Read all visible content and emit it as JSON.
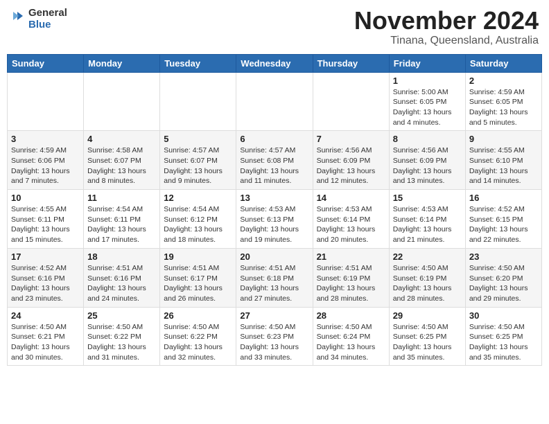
{
  "header": {
    "logo_general": "General",
    "logo_blue": "Blue",
    "month": "November 2024",
    "location": "Tinana, Queensland, Australia"
  },
  "weekdays": [
    "Sunday",
    "Monday",
    "Tuesday",
    "Wednesday",
    "Thursday",
    "Friday",
    "Saturday"
  ],
  "weeks": [
    [
      {
        "day": "",
        "info": ""
      },
      {
        "day": "",
        "info": ""
      },
      {
        "day": "",
        "info": ""
      },
      {
        "day": "",
        "info": ""
      },
      {
        "day": "",
        "info": ""
      },
      {
        "day": "1",
        "info": "Sunrise: 5:00 AM\nSunset: 6:05 PM\nDaylight: 13 hours\nand 4 minutes."
      },
      {
        "day": "2",
        "info": "Sunrise: 4:59 AM\nSunset: 6:05 PM\nDaylight: 13 hours\nand 5 minutes."
      }
    ],
    [
      {
        "day": "3",
        "info": "Sunrise: 4:59 AM\nSunset: 6:06 PM\nDaylight: 13 hours\nand 7 minutes."
      },
      {
        "day": "4",
        "info": "Sunrise: 4:58 AM\nSunset: 6:07 PM\nDaylight: 13 hours\nand 8 minutes."
      },
      {
        "day": "5",
        "info": "Sunrise: 4:57 AM\nSunset: 6:07 PM\nDaylight: 13 hours\nand 9 minutes."
      },
      {
        "day": "6",
        "info": "Sunrise: 4:57 AM\nSunset: 6:08 PM\nDaylight: 13 hours\nand 11 minutes."
      },
      {
        "day": "7",
        "info": "Sunrise: 4:56 AM\nSunset: 6:09 PM\nDaylight: 13 hours\nand 12 minutes."
      },
      {
        "day": "8",
        "info": "Sunrise: 4:56 AM\nSunset: 6:09 PM\nDaylight: 13 hours\nand 13 minutes."
      },
      {
        "day": "9",
        "info": "Sunrise: 4:55 AM\nSunset: 6:10 PM\nDaylight: 13 hours\nand 14 minutes."
      }
    ],
    [
      {
        "day": "10",
        "info": "Sunrise: 4:55 AM\nSunset: 6:11 PM\nDaylight: 13 hours\nand 15 minutes."
      },
      {
        "day": "11",
        "info": "Sunrise: 4:54 AM\nSunset: 6:11 PM\nDaylight: 13 hours\nand 17 minutes."
      },
      {
        "day": "12",
        "info": "Sunrise: 4:54 AM\nSunset: 6:12 PM\nDaylight: 13 hours\nand 18 minutes."
      },
      {
        "day": "13",
        "info": "Sunrise: 4:53 AM\nSunset: 6:13 PM\nDaylight: 13 hours\nand 19 minutes."
      },
      {
        "day": "14",
        "info": "Sunrise: 4:53 AM\nSunset: 6:14 PM\nDaylight: 13 hours\nand 20 minutes."
      },
      {
        "day": "15",
        "info": "Sunrise: 4:53 AM\nSunset: 6:14 PM\nDaylight: 13 hours\nand 21 minutes."
      },
      {
        "day": "16",
        "info": "Sunrise: 4:52 AM\nSunset: 6:15 PM\nDaylight: 13 hours\nand 22 minutes."
      }
    ],
    [
      {
        "day": "17",
        "info": "Sunrise: 4:52 AM\nSunset: 6:16 PM\nDaylight: 13 hours\nand 23 minutes."
      },
      {
        "day": "18",
        "info": "Sunrise: 4:51 AM\nSunset: 6:16 PM\nDaylight: 13 hours\nand 24 minutes."
      },
      {
        "day": "19",
        "info": "Sunrise: 4:51 AM\nSunset: 6:17 PM\nDaylight: 13 hours\nand 26 minutes."
      },
      {
        "day": "20",
        "info": "Sunrise: 4:51 AM\nSunset: 6:18 PM\nDaylight: 13 hours\nand 27 minutes."
      },
      {
        "day": "21",
        "info": "Sunrise: 4:51 AM\nSunset: 6:19 PM\nDaylight: 13 hours\nand 28 minutes."
      },
      {
        "day": "22",
        "info": "Sunrise: 4:50 AM\nSunset: 6:19 PM\nDaylight: 13 hours\nand 28 minutes."
      },
      {
        "day": "23",
        "info": "Sunrise: 4:50 AM\nSunset: 6:20 PM\nDaylight: 13 hours\nand 29 minutes."
      }
    ],
    [
      {
        "day": "24",
        "info": "Sunrise: 4:50 AM\nSunset: 6:21 PM\nDaylight: 13 hours\nand 30 minutes."
      },
      {
        "day": "25",
        "info": "Sunrise: 4:50 AM\nSunset: 6:22 PM\nDaylight: 13 hours\nand 31 minutes."
      },
      {
        "day": "26",
        "info": "Sunrise: 4:50 AM\nSunset: 6:22 PM\nDaylight: 13 hours\nand 32 minutes."
      },
      {
        "day": "27",
        "info": "Sunrise: 4:50 AM\nSunset: 6:23 PM\nDaylight: 13 hours\nand 33 minutes."
      },
      {
        "day": "28",
        "info": "Sunrise: 4:50 AM\nSunset: 6:24 PM\nDaylight: 13 hours\nand 34 minutes."
      },
      {
        "day": "29",
        "info": "Sunrise: 4:50 AM\nSunset: 6:25 PM\nDaylight: 13 hours\nand 35 minutes."
      },
      {
        "day": "30",
        "info": "Sunrise: 4:50 AM\nSunset: 6:25 PM\nDaylight: 13 hours\nand 35 minutes."
      }
    ]
  ]
}
